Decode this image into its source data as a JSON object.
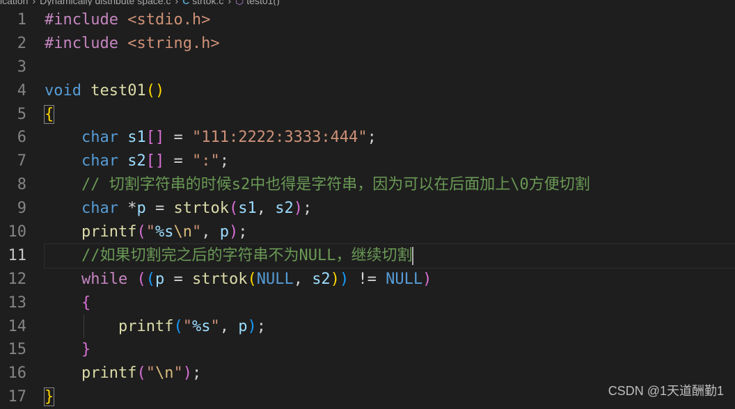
{
  "breadcrumb": {
    "folder_fragment": "ication",
    "file_folder": "Dynamically distribute space.c",
    "file_icon": "C",
    "file": "strtok.c",
    "symbol_icon": "function-cube-icon",
    "symbol": "test01()"
  },
  "editor": {
    "active_line": 11,
    "line_numbers": [
      "1",
      "2",
      "3",
      "4",
      "5",
      "6",
      "7",
      "8",
      "9",
      "10",
      "11",
      "12",
      "13",
      "14",
      "15",
      "16",
      "17"
    ]
  },
  "code": {
    "l1": {
      "directive": "#include",
      "header": "<stdio.h>"
    },
    "l2": {
      "directive": "#include",
      "header": "<string.h>"
    },
    "l4": {
      "ret_type": "void",
      "fn_name": "test01",
      "parens": "()"
    },
    "l5": {
      "brace": "{"
    },
    "l6": {
      "type": "char",
      "var": "s1",
      "brackets": "[]",
      "eq": " = ",
      "literal": "\"111:2222:3333:444\"",
      "semi": ";"
    },
    "l7": {
      "type": "char",
      "var": "s2",
      "brackets": "[]",
      "eq": " = ",
      "literal": "\":\"",
      "semi": ";"
    },
    "l8": {
      "comment": "// 切割字符串的时候s2中也得是字符串，因为可以在后面加上\\0方便切割"
    },
    "l9": {
      "type": "char",
      "ptr": " *",
      "var": "p",
      "eq": " = ",
      "fn": "strtok",
      "open": "(",
      "arg1": "s1",
      "comma": ", ",
      "arg2": "s2",
      "close": ")",
      "semi": ";"
    },
    "l10": {
      "fn": "printf",
      "open": "(",
      "q1": "\"",
      "fmt": "%s",
      "esc": "\\n",
      "q2": "\"",
      "comma": ", ",
      "arg": "p",
      "close": ")",
      "semi": ";"
    },
    "l11": {
      "comment": "//如果切割完之后的字符串不为NULL，继续切割"
    },
    "l12": {
      "kw": "while",
      "sp": " ",
      "open1": "(",
      "open2": "(",
      "var": "p",
      "eq": " = ",
      "fn": "strtok",
      "open3": "(",
      "arg1": "NULL",
      "comma": ", ",
      "arg2": "s2",
      "close3": ")",
      "close2": ")",
      "neq": " != ",
      "null": "NULL",
      "close1": ")"
    },
    "l13": {
      "brace": "{"
    },
    "l14": {
      "fn": "printf",
      "open": "(",
      "q1": "\"",
      "fmt": "%s",
      "q2": "\"",
      "comma": ", ",
      "arg": "p",
      "close": ")",
      "semi": ";"
    },
    "l15": {
      "brace": "}"
    },
    "l16": {
      "fn": "printf",
      "open": "(",
      "q1": "\"",
      "esc": "\\n",
      "q2": "\"",
      "close": ")",
      "semi": ";"
    },
    "l17": {
      "brace": "}"
    }
  },
  "watermark": "CSDN @1天道酬勤1",
  "colors": {
    "background": "#1e1e1e",
    "keyword": "#569cd6",
    "control": "#c586c0",
    "function": "#dcdcaa",
    "variable": "#9cdcfe",
    "string": "#ce9178",
    "comment": "#6a9955",
    "bracket_level1": "#ffd700",
    "bracket_level2": "#da70d6",
    "bracket_level3": "#179fff"
  }
}
